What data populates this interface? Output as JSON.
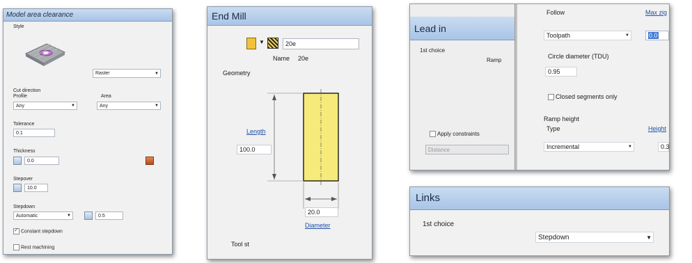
{
  "model_area_clearance": {
    "title": "Model area clearance",
    "style_label": "Style",
    "style_value": "Raster",
    "cut_direction_label": "Cut direction",
    "profile_label": "Profile",
    "profile_value": "Any",
    "area_label": "Area",
    "area_value": "Any",
    "tolerance_label": "Tolerance",
    "tolerance_value": "0.1",
    "thickness_label": "Thickness",
    "thickness_value": "0.0",
    "stepover_label": "Stepover",
    "stepover_value": "10.0",
    "stepdown_label": "Stepdown",
    "stepdown_mode": "Automatic",
    "stepdown_value": "0.5",
    "constant_stepdown_label": "Constant stepdown",
    "constant_stepdown_checked": true,
    "rest_machining_label": "Rest machining",
    "rest_machining_checked": false
  },
  "end_mill": {
    "title": "End Mill",
    "tool_name_combo": "20e",
    "name_label": "Name",
    "name_value": "20e",
    "geometry_label": "Geometry",
    "length_link": "Length",
    "length_value": "100.0",
    "diameter_value": "20.0",
    "diameter_link": "Diameter",
    "bottom_partial": "Tool st",
    "colors": {
      "tool_fill": "#f5ea7a"
    }
  },
  "lead_in": {
    "title": "Lead in",
    "first_choice_label": "1st choice",
    "ramp_label": "Ramp",
    "apply_constraints_label": "Apply constraints",
    "apply_constraints_checked": false,
    "distance_placeholder": "Distance",
    "follow_label": "Follow",
    "follow_value": "Toolpath",
    "max_zig_link": "Max zig",
    "max_zig_value": "0.0",
    "circle_diameter_label": "Circle diameter (TDU)",
    "circle_diameter_value": "0.95",
    "closed_segments_label": "Closed segments only",
    "closed_segments_checked": false,
    "ramp_height_label": "Ramp height",
    "type_label": "Type",
    "type_value": "Incremental",
    "height_link": "Height",
    "height_value": "0.3"
  },
  "links": {
    "title": "Links",
    "first_choice_label": "1st choice",
    "first_choice_value": "Stepdown"
  }
}
